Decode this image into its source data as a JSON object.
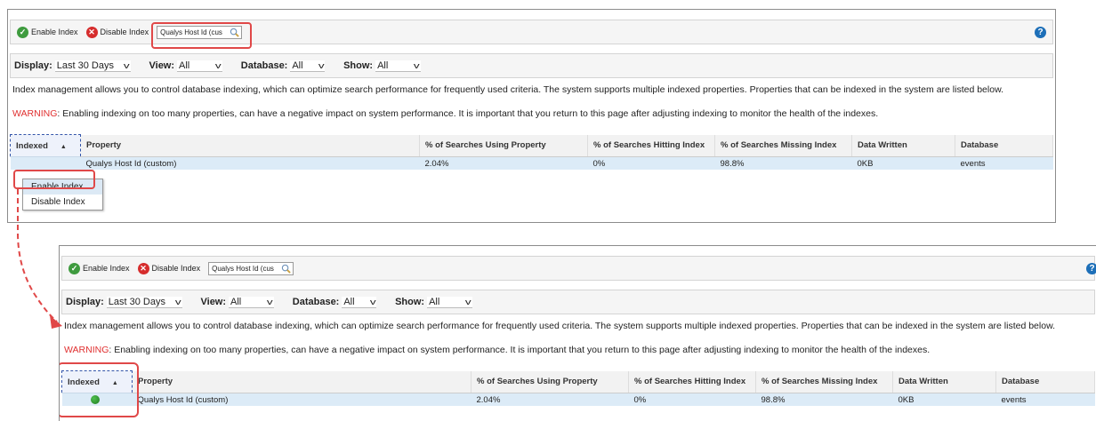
{
  "toolbar": {
    "enable_label": "Enable Index",
    "disable_label": "Disable Index",
    "search_value": "Qualys Host Id (cus",
    "help": "?"
  },
  "filters": {
    "display_label": "Display:",
    "display_value": "Last 30 Days",
    "view_label": "View:",
    "view_value": "All",
    "database_label": "Database:",
    "database_value": "All",
    "show_label": "Show:",
    "show_value": "All"
  },
  "info_text": "Index management allows you to control database indexing, which can optimize search performance for frequently used criteria. The system supports multiple indexed properties. Properties that can be indexed in the system are listed below.",
  "warning": {
    "label": "WARNING",
    "text": ": Enabling indexing on too many properties, can have a negative impact on system performance. It is important that you return to this page after adjusting indexing to monitor the health of the indexes."
  },
  "table": {
    "columns": [
      "Indexed",
      "Property",
      "% of Searches Using Property",
      "% of Searches Hitting Index",
      "% of Searches Missing Index",
      "Data Written",
      "Database"
    ],
    "row": {
      "property": "Qualys Host Id (custom)",
      "using": "2.04%",
      "hitting": "0%",
      "missing": "98.8%",
      "written": "0KB",
      "database": "events"
    }
  },
  "context_menu": {
    "enable": "Enable Index",
    "disable": "Disable Index"
  },
  "colors": {
    "highlight": "#e04848",
    "row_bg": "#dcebf7",
    "warning": "#e03030"
  }
}
